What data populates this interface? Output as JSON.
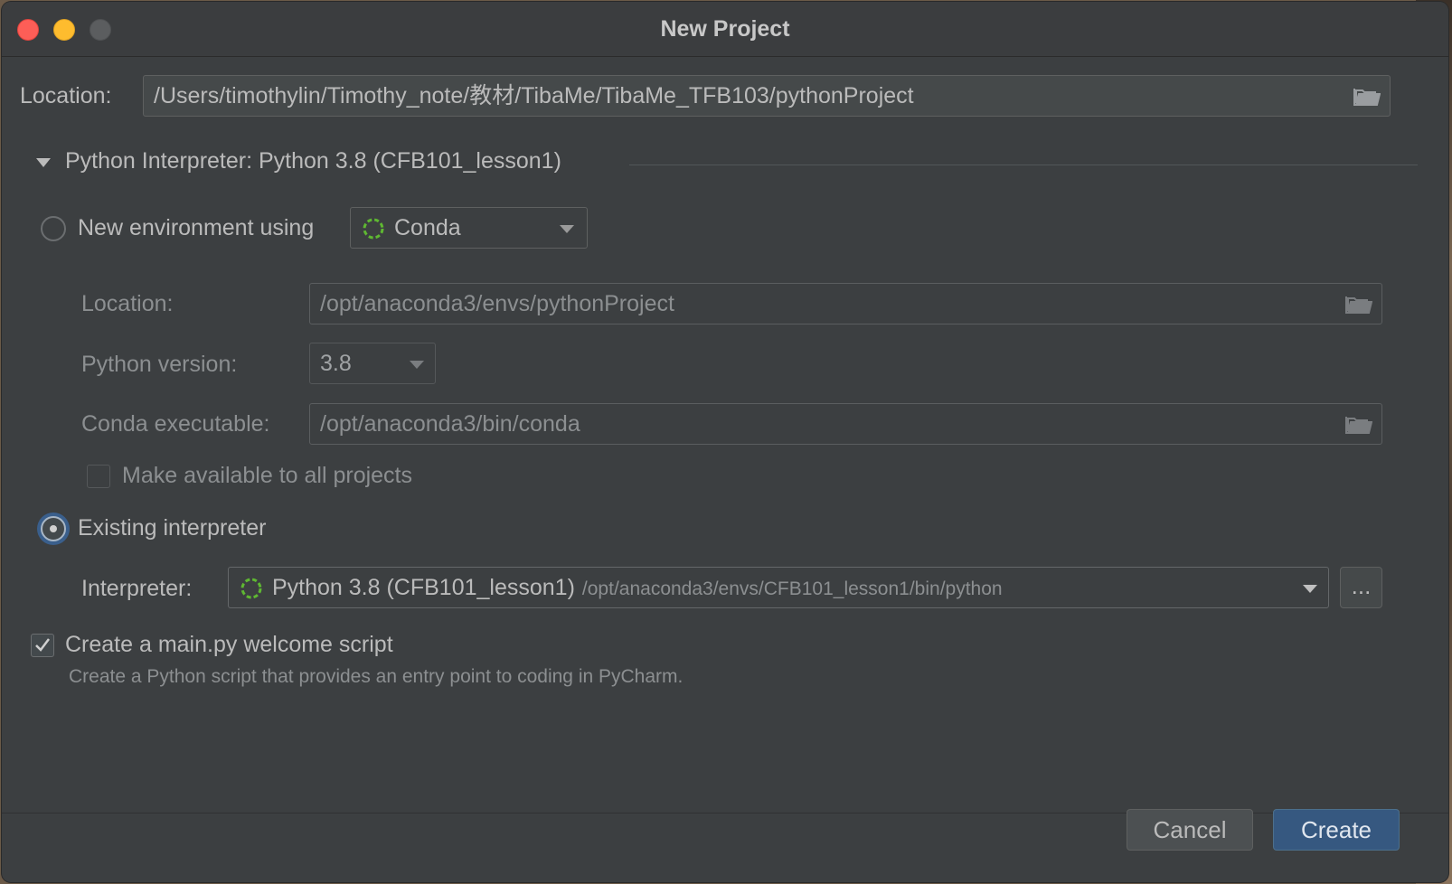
{
  "window": {
    "title": "New Project"
  },
  "project": {
    "location_label": "Location:",
    "location_value": "/Users/timothylin/Timothy_note/教材/TibaMe/TibaMe_TFB103/pythonProject"
  },
  "interpreter_section": {
    "header": "Python Interpreter: Python 3.8 (CFB101_lesson1)",
    "expanded": true
  },
  "new_env": {
    "radio_label": "New environment using",
    "selected": false,
    "tool": "Conda",
    "location_label": "Location:",
    "location_value": "/opt/anaconda3/envs/pythonProject",
    "python_version_label": "Python version:",
    "python_version_value": "3.8",
    "conda_exec_label": "Conda executable:",
    "conda_exec_value": "/opt/anaconda3/bin/conda",
    "make_available_label": "Make available to all projects",
    "make_available_checked": false
  },
  "existing": {
    "radio_label": "Existing interpreter",
    "selected": true,
    "interpreter_label": "Interpreter:",
    "interpreter_name": "Python 3.8 (CFB101_lesson1)",
    "interpreter_path": "/opt/anaconda3/envs/CFB101_lesson1/bin/python",
    "more_button": "..."
  },
  "welcome_script": {
    "label": "Create a main.py welcome script",
    "checked": true,
    "description": "Create a Python script that provides an entry point to coding in PyCharm."
  },
  "buttons": {
    "cancel": "Cancel",
    "create": "Create"
  },
  "colors": {
    "background": "#3c3f41",
    "accent": "#365880",
    "conda_green": "#5fb832"
  }
}
